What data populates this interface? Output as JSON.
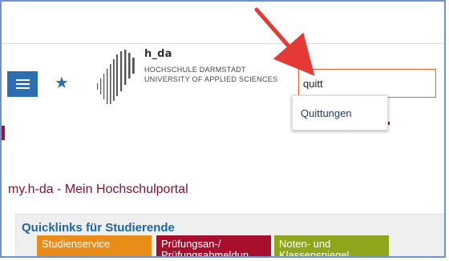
{
  "header": {
    "logo": {
      "name": "h_da",
      "line1": "HOCHSCHULE DARMSTADT",
      "line2": "UNIVERSITY OF APPLIED SCIENCES"
    },
    "menu_icon": "hamburger-icon",
    "favorite_icon": "star-icon"
  },
  "search": {
    "value": "quitt",
    "suggestions": [
      "Quittungen"
    ]
  },
  "page": {
    "title": "my.h-da - Mein Hochschulportal"
  },
  "quicklinks": {
    "title": "Quicklinks für Studierende",
    "tiles": [
      {
        "label": "Studienservice"
      },
      {
        "label": "Prüfungsan-/ Prüfungsabmeldun"
      },
      {
        "label": "Noten- und Klassenspiegel"
      }
    ]
  },
  "annotation": {
    "arrow_color": "#e53935"
  },
  "colors": {
    "accent_blue": "#2b6fb2",
    "brand_red": "#a0123a",
    "search_border": "#e06a2c"
  }
}
